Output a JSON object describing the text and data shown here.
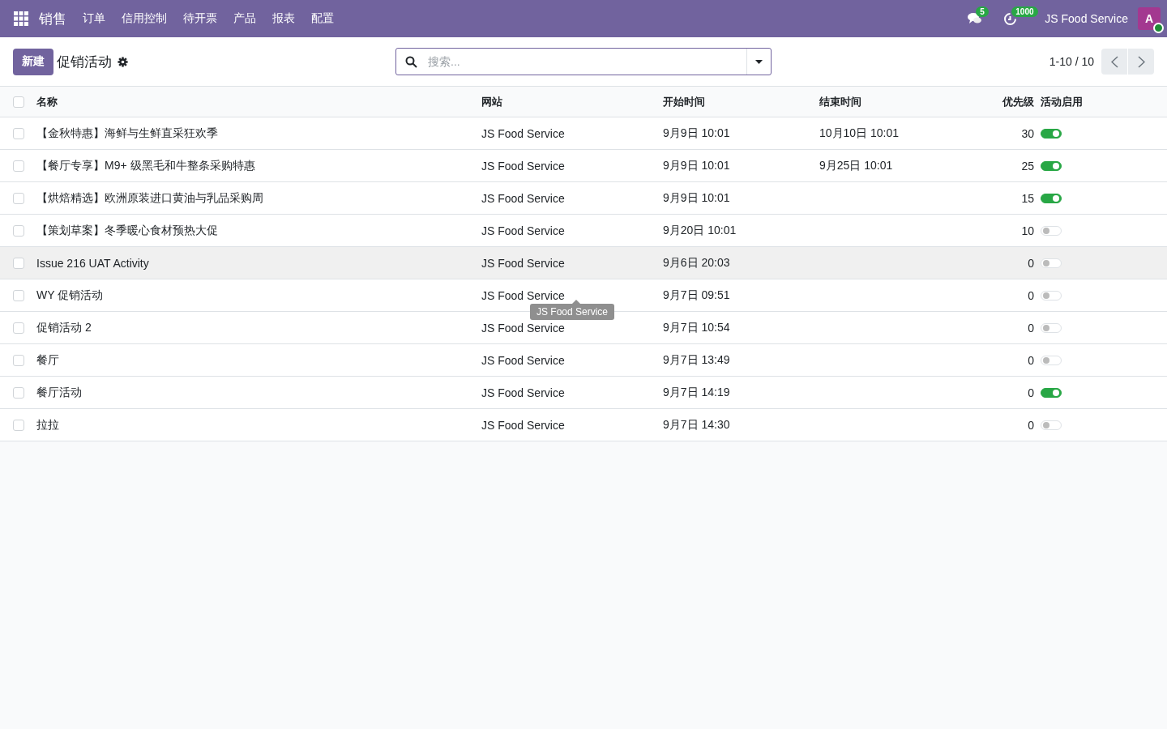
{
  "navbar": {
    "app": "销售",
    "menu": [
      "订单",
      "信用控制",
      "待开票",
      "产品",
      "报表",
      "配置"
    ],
    "messages_count": "5",
    "activities_count": "1000",
    "company": "JS Food Service",
    "avatar": "A"
  },
  "control_panel": {
    "new_button": "新建",
    "title": "促销活动",
    "search": {
      "placeholder": "搜索..."
    },
    "pager": "1-10 / 10"
  },
  "table": {
    "all_selected": false,
    "columns": [
      "名称",
      "网站",
      "开始时间",
      "结束时间",
      "优先级",
      "活动启用"
    ],
    "rows": [
      {
        "name": "【金秋特惠】海鲜与生鲜直采狂欢季",
        "website": "JS Food Service",
        "start": "9月9日 10:01",
        "end": "10月10日 10:01",
        "priority": "30",
        "active": true,
        "hovered": false
      },
      {
        "name": "【餐厅专享】M9+ 级黑毛和牛整条采购特惠",
        "website": "JS Food Service",
        "start": "9月9日 10:01",
        "end": "9月25日 10:01",
        "priority": "25",
        "active": true,
        "hovered": false
      },
      {
        "name": "【烘焙精选】欧洲原装进口黄油与乳品采购周",
        "website": "JS Food Service",
        "start": "9月9日 10:01",
        "priority": "15",
        "active": true,
        "hovered": false
      },
      {
        "name": "【策划草案】冬季暖心食材预热大促",
        "website": "JS Food Service",
        "start": "9月20日 10:01",
        "priority": "10",
        "active": false,
        "hovered": false
      },
      {
        "name": "Issue 216 UAT Activity",
        "website": "JS Food Service",
        "start": "9月6日 20:03",
        "priority": "0",
        "active": false,
        "hovered": true
      },
      {
        "name": "WY 促销活动",
        "website": "JS Food Service",
        "start": "9月7日 09:51",
        "priority": "0",
        "active": false,
        "hovered": false
      },
      {
        "name": "促销活动 2",
        "website": "JS Food Service",
        "start": "9月7日 10:54",
        "priority": "0",
        "active": false,
        "hovered": false
      },
      {
        "name": "餐厅",
        "website": "JS Food Service",
        "start": "9月7日 13:49",
        "priority": "0",
        "active": false,
        "hovered": false
      },
      {
        "name": "餐厅活动",
        "website": "JS Food Service",
        "start": "9月7日 14:19",
        "priority": "0",
        "active": true,
        "hovered": false
      },
      {
        "name": "拉拉",
        "website": "JS Food Service",
        "start": "9月7日 14:30",
        "priority": "0",
        "active": false,
        "hovered": false
      }
    ]
  },
  "tooltip": {
    "text": "JS Food Service"
  }
}
